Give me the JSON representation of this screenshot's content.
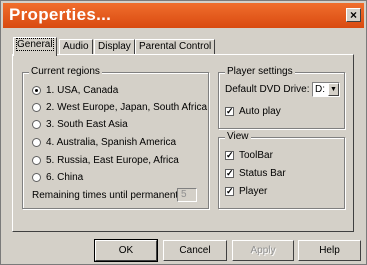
{
  "dialog": {
    "title": "Properties...",
    "close_label": "×"
  },
  "tabs": [
    "General",
    "Audio",
    "Display",
    "Parental Control"
  ],
  "regions": {
    "label": "Current regions",
    "options": [
      "1. USA, Canada",
      "2. West Europe, Japan, South Africa",
      "3. South East Asia",
      "4. Australia, Spanish America",
      "5. Russia, East Europe, Africa",
      "6. China"
    ],
    "selected": 0,
    "remaining_label": "Remaining times until permanent:",
    "remaining_value": "5"
  },
  "player_settings": {
    "label": "Player settings",
    "drive_label": "Default DVD Drive:",
    "drive_value": "D:",
    "autoplay_label": "Auto play",
    "autoplay_checked": true
  },
  "view": {
    "label": "View",
    "items": [
      {
        "label": "ToolBar",
        "checked": true
      },
      {
        "label": "Status Bar",
        "checked": true
      },
      {
        "label": "Player",
        "checked": true
      }
    ]
  },
  "buttons": {
    "ok": "OK",
    "cancel": "Cancel",
    "apply": "Apply",
    "help": "Help"
  }
}
